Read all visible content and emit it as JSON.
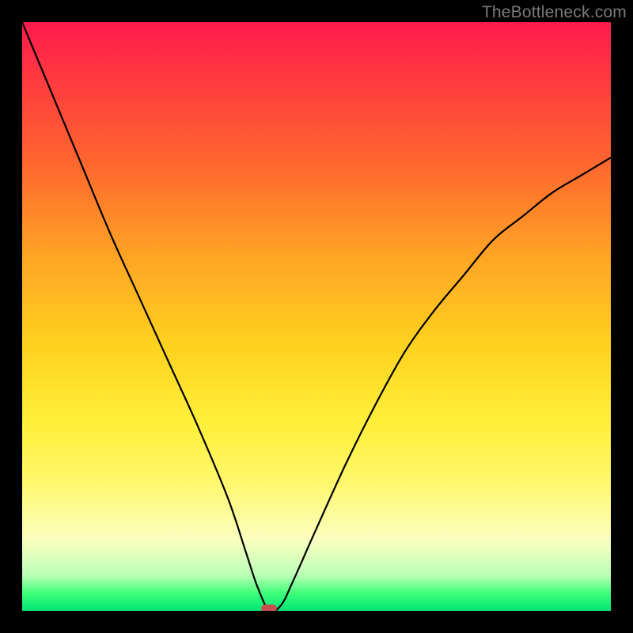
{
  "watermark_text": "TheBottleneck.com",
  "chart_data": {
    "type": "line",
    "title": "",
    "xlabel": "",
    "ylabel": "",
    "ylim": [
      0,
      100
    ],
    "xlim": [
      0,
      100
    ],
    "x": [
      0,
      5,
      10,
      15,
      20,
      25,
      30,
      35,
      38,
      40,
      42,
      44,
      46,
      50,
      55,
      60,
      65,
      70,
      75,
      80,
      85,
      90,
      95,
      100
    ],
    "values": [
      100,
      88,
      76,
      64,
      53,
      42,
      31,
      19,
      10,
      4,
      0,
      1,
      5,
      14,
      25,
      35,
      44,
      51,
      57,
      63,
      67,
      71,
      74,
      77
    ],
    "note": "V-shaped bottleneck curve; minimum (0%) at x≈42. Values estimated from gradient position.",
    "marker": {
      "x": 42,
      "y": 0,
      "color": "#c6504e"
    },
    "gradient_stops": [
      {
        "pos": 0,
        "color": "#ff1a4d"
      },
      {
        "pos": 55,
        "color": "#ffd21f"
      },
      {
        "pos": 100,
        "color": "#00e676"
      }
    ]
  }
}
